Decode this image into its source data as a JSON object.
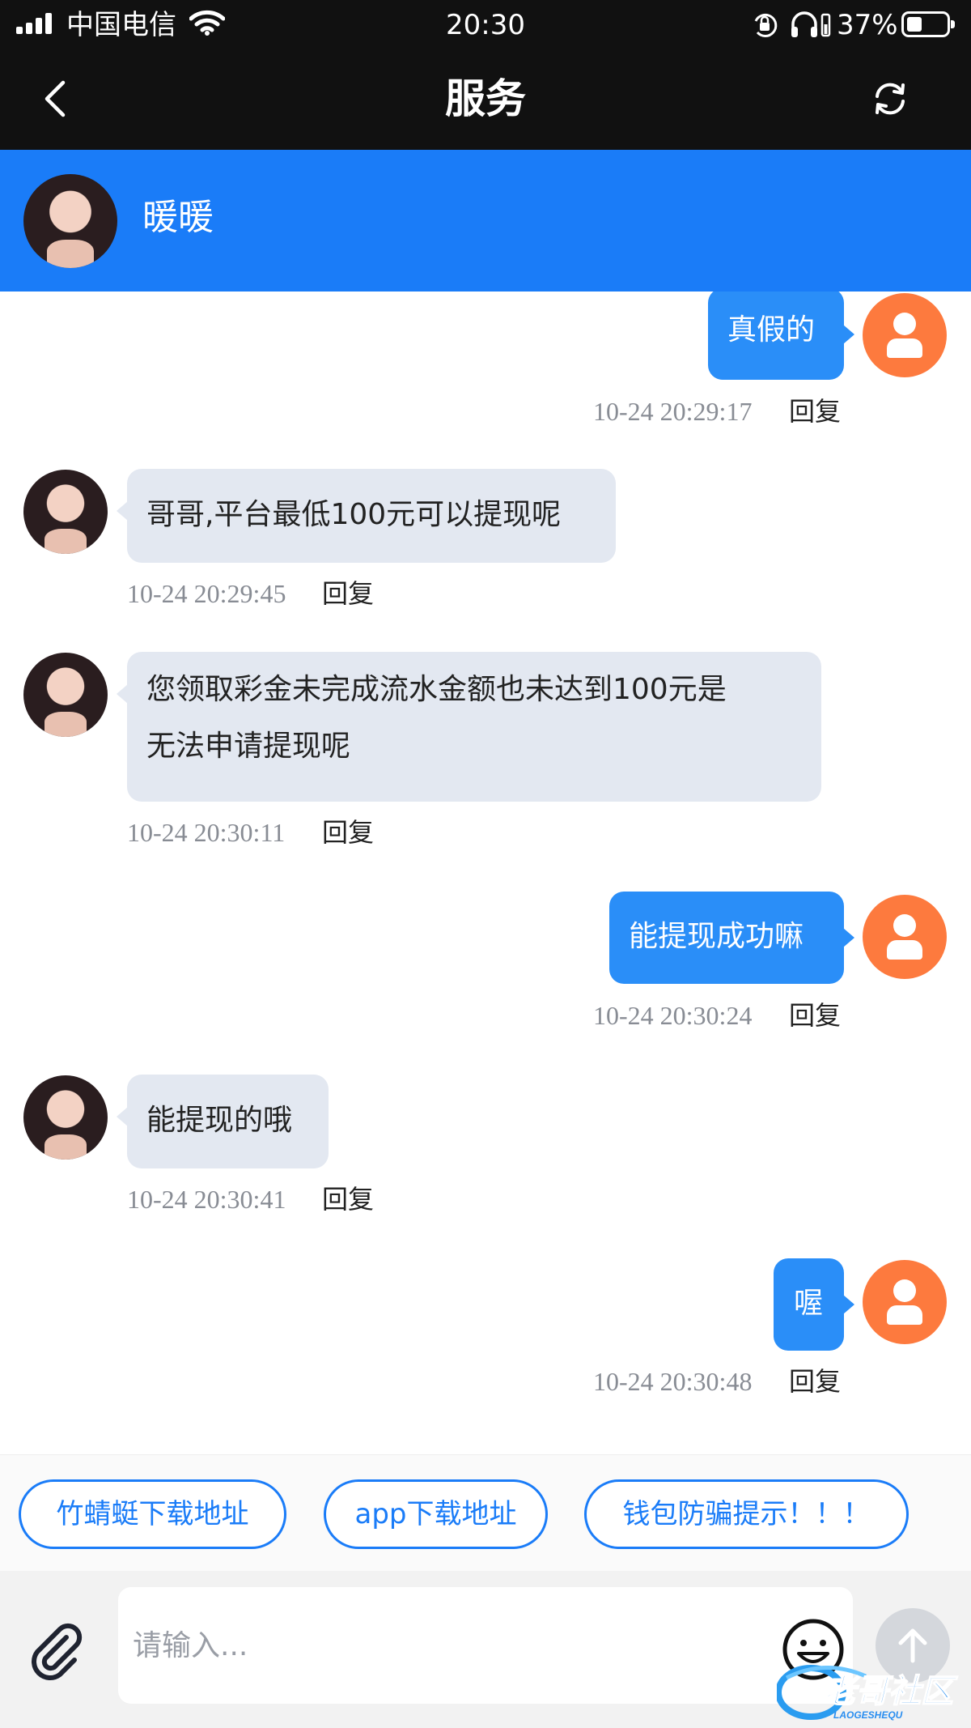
{
  "status_bar": {
    "carrier": "中国电信",
    "time": "20:30",
    "battery_percent": "37%",
    "battery_level": 0.37,
    "icons": [
      "signal-icon",
      "wifi-icon",
      "orientation-lock-icon",
      "headphone-icon",
      "battery-icon"
    ]
  },
  "nav": {
    "title": "服务",
    "back_icon": "chevron-left-icon",
    "refresh_icon": "refresh-icon"
  },
  "agent": {
    "name": "暖暖"
  },
  "messages": [
    {
      "direction": "out",
      "text": "真假的",
      "time": "10-24 20:29:17",
      "reply": "回复"
    },
    {
      "direction": "in",
      "text": "哥哥,平台最低100元可以提现呢",
      "time": "10-24 20:29:45",
      "reply": "回复"
    },
    {
      "direction": "in",
      "text": "您领取彩金未完成流水金额也未达到100元是",
      "text_line2": "无法申请提现呢",
      "time": "10-24 20:30:11",
      "reply": "回复"
    },
    {
      "direction": "out",
      "text": "能提现成功嘛",
      "time": "10-24 20:30:24",
      "reply": "回复"
    },
    {
      "direction": "in",
      "text": "能提现的哦",
      "time": "10-24 20:30:41",
      "reply": "回复"
    },
    {
      "direction": "out",
      "text": "喔",
      "time": "10-24 20:30:48",
      "reply": "回复"
    }
  ],
  "quick_replies": [
    "竹蜻蜓下载地址",
    "app下载地址",
    "钱包防骗提示！！！"
  ],
  "input": {
    "placeholder": "请输入..."
  },
  "watermark": {
    "title": "老哥社区",
    "subtitle": "LAOGESHEQU"
  },
  "colors": {
    "header_blue": "#1a7cf8",
    "outgoing_bubble": "#2a8ef8",
    "incoming_bubble": "#e3e8f1",
    "user_avatar": "#fd7a3e",
    "top_bar": "#111111"
  }
}
